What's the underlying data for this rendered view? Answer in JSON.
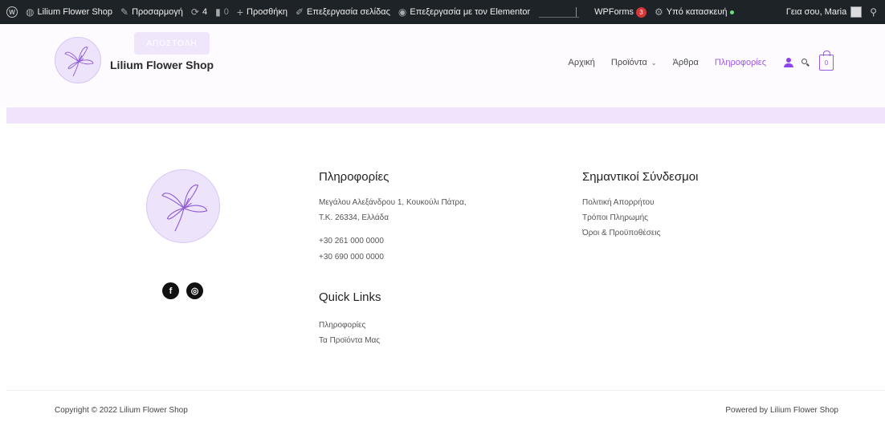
{
  "admin_bar": {
    "site_name": "Lilium Flower Shop",
    "customize": "Προσαρμογή",
    "updates_count": "4",
    "comments_count": "0",
    "new_label": "Προσθήκη",
    "edit_page": "Επεξεργασία σελίδας",
    "edit_elementor": "Επεξεργασία με τον Elementor",
    "wpforms": "WPForms",
    "wpforms_badge": "3",
    "maintenance": "Υπό κατασκευή",
    "greeting": "Γεια σου, Maria"
  },
  "header": {
    "ghost_button": "ΑΠΟΣΤΟΛΗ",
    "site_title": "Lilium Flower Shop",
    "nav": [
      {
        "label": "Αρχική"
      },
      {
        "label": "Προϊόντα"
      },
      {
        "label": "Άρθρα"
      },
      {
        "label": "Πληροφορίες"
      }
    ],
    "cart_count": "0",
    "accent_color": "#9b59e8"
  },
  "footer": {
    "social": [
      {
        "icon": "facebook-icon",
        "glyph": "f"
      },
      {
        "icon": "instagram-icon",
        "glyph": "◎"
      }
    ],
    "info": {
      "title": "Πληροφορίες",
      "address1": "Μεγάλου Αλεξάνδρου 1, Κουκούλι Πάτρα,",
      "address2": "Τ.Κ. 26334, Ελλάδα",
      "phone1": "+30 261 000 0000",
      "phone2": "+30 690 000 0000"
    },
    "quick_links": {
      "title": "Quick Links",
      "links": [
        "Πληροφορίες",
        "Τα Προϊόντα Μας"
      ]
    },
    "important": {
      "title": "Σημαντικοί Σύνδεσμοι",
      "links": [
        "Πολιτική Απορρήτου",
        "Τρόποι Πληρωμής",
        "Όροι & Προϋποθέσεις"
      ]
    },
    "copyright": "Copyright © 2022 Lilium Flower Shop",
    "powered": "Powered by Lilium Flower Shop"
  }
}
